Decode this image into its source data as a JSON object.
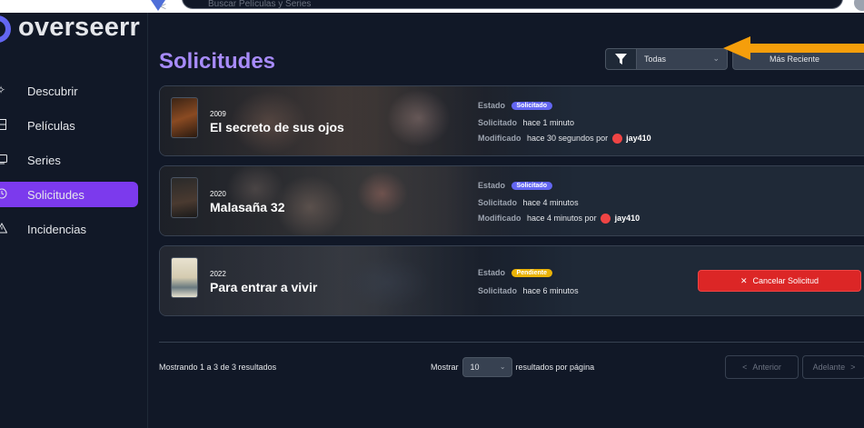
{
  "app": {
    "name": "overseerr",
    "search_placeholder": "Buscar Películas y Series"
  },
  "sidebar": {
    "items": [
      {
        "label": "Descubrir",
        "icon": "sparkles-icon",
        "active": false
      },
      {
        "label": "Películas",
        "icon": "film-icon",
        "active": false
      },
      {
        "label": "Series",
        "icon": "tv-icon",
        "active": false
      },
      {
        "label": "Solicitudes",
        "icon": "clock-icon",
        "active": true
      },
      {
        "label": "Incidencias",
        "icon": "warning-icon",
        "active": false
      }
    ]
  },
  "main": {
    "title": "Solicitudes",
    "filter": {
      "icon": "filter-icon",
      "value": "Todas"
    },
    "sort": {
      "value": "Más Reciente"
    }
  },
  "requests": [
    {
      "year": "2009",
      "title": "El secreto de sus ojos",
      "status_label": "Estado",
      "status": "Solicitado",
      "requested_label": "Solicitado",
      "requested": "hace 1 minuto",
      "modified_label": "Modificado",
      "modified": "hace 30 segundos por",
      "user": "jay410"
    },
    {
      "year": "2020",
      "title": "Malasaña 32",
      "status_label": "Estado",
      "status": "Solicitado",
      "requested_label": "Solicitado",
      "requested": "hace 4 minutos",
      "modified_label": "Modificado",
      "modified": "hace 4 minutos por",
      "user": "jay410"
    },
    {
      "year": "2022",
      "title": "Para entrar a vivir",
      "status_label": "Estado",
      "status": "Pendiente",
      "requested_label": "Solicitado",
      "requested": "hace 6 minutos",
      "cancel_label": "Cancelar Solicitud"
    }
  ],
  "footer": {
    "count_text": "Mostrando 1 a 3 de 3 resultados",
    "show_label": "Mostrar",
    "page_size": "10",
    "per_page_label": "resultados por página",
    "prev_label": "Anterior",
    "next_label": "Adelante"
  },
  "colors": {
    "accent": "#7c3aed",
    "title": "#a78bfa",
    "badge_requested": "#6366f1",
    "badge_pending": "#eab308",
    "cancel": "#dc2626",
    "annotation_arrow": "#f59e0b"
  }
}
